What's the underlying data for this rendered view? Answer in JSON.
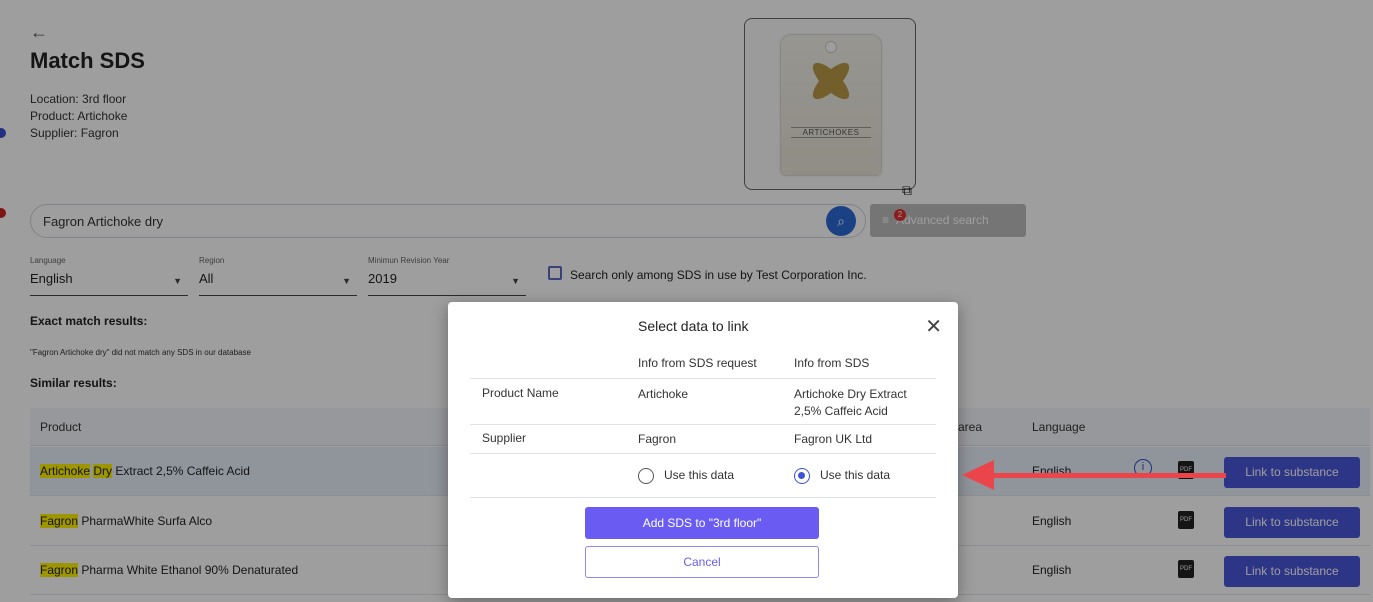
{
  "header": {
    "back_icon": "arrow-left",
    "title": "Match SDS",
    "location": "Location: 3rd floor",
    "product": "Product: Artichoke",
    "supplier": "Supplier: Fagron"
  },
  "product_image": {
    "label": "ARTICHOKES",
    "open_icon": "external-link"
  },
  "search": {
    "value": "Fagron Artichoke dry",
    "search_icon": "search",
    "advanced_label": "Advanced search",
    "advanced_badge": "2"
  },
  "filters": {
    "language": {
      "label": "Language",
      "value": "English"
    },
    "region": {
      "label": "Region",
      "value": "All"
    },
    "min_revision": {
      "label": "Minimun Revision Year",
      "value": "2019"
    },
    "in_use_only": {
      "label": "Search only among SDS in use by Test Corporation Inc.",
      "checked": false
    }
  },
  "results": {
    "exact_label": "Exact match results:",
    "no_match_note": "\"Fagron Artichoke dry\" did not match any SDS in our database",
    "similar_label": "Similar results:",
    "columns": {
      "product": "Product",
      "area": "area",
      "language": "Language"
    },
    "rows": [
      {
        "hl1": "Artichoke",
        "hl2": "Dry",
        "rest": " Extract 2,5% Caffeic Acid",
        "language": "English",
        "action": "Link to substance"
      },
      {
        "hl1": "Fagron",
        "rest": " PharmaWhite Surfa Alco",
        "language": "English",
        "action": "Link to substance"
      },
      {
        "hl1": "Fagron",
        "rest": " Pharma White Ethanol 90% Denaturated",
        "language": "English",
        "action": "Link to substance"
      }
    ]
  },
  "modal": {
    "title": "Select data to link",
    "close_icon": "close-x",
    "col_request": "Info from SDS request",
    "col_sds": "Info from SDS",
    "rows": [
      {
        "label": "Product Name",
        "request": "Artichoke",
        "sds_line1": "Artichoke Dry Extract",
        "sds_line2": "2,5% Caffeic Acid"
      },
      {
        "label": "Supplier",
        "request": "Fagron",
        "sds_line1": "Fagron UK Ltd"
      }
    ],
    "radio_request": "Use this data",
    "radio_sds": "Use this data",
    "selected": "sds",
    "primary_button": "Add SDS to \"3rd floor\"",
    "cancel_button": "Cancel"
  },
  "colors": {
    "accent": "#6a5cf2",
    "link_button": "#4a56d8",
    "annotation_arrow": "#e9454a",
    "highlight": "#fff200"
  }
}
